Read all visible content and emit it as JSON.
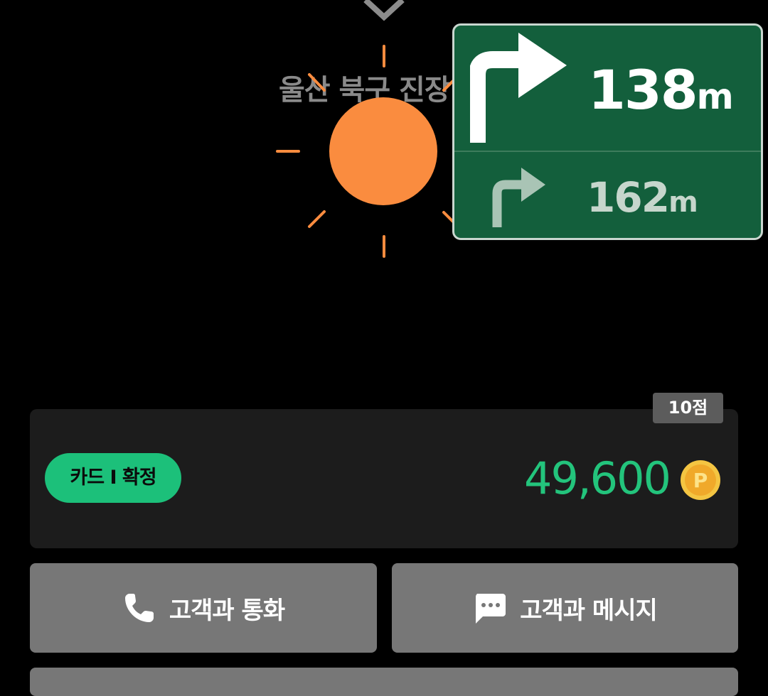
{
  "map": {
    "label": "울산 북구 진장",
    "sun_color": "#fa8c3f"
  },
  "navigation": {
    "primary": {
      "direction": "right-turn",
      "distance": "138",
      "unit": "m"
    },
    "secondary": {
      "direction": "right-turn",
      "distance": "162",
      "unit": "m"
    },
    "sign_color": "#135f3c"
  },
  "fare": {
    "score": "10점",
    "payment_status": "카드 I 확정",
    "amount": "49,600",
    "point_icon_letter": "P",
    "amount_color": "#23c47c"
  },
  "actions": {
    "call_label": "고객과 통화",
    "message_label": "고객과 메시지",
    "call_icon": "phone-icon",
    "message_icon": "chat-bubble-icon"
  }
}
